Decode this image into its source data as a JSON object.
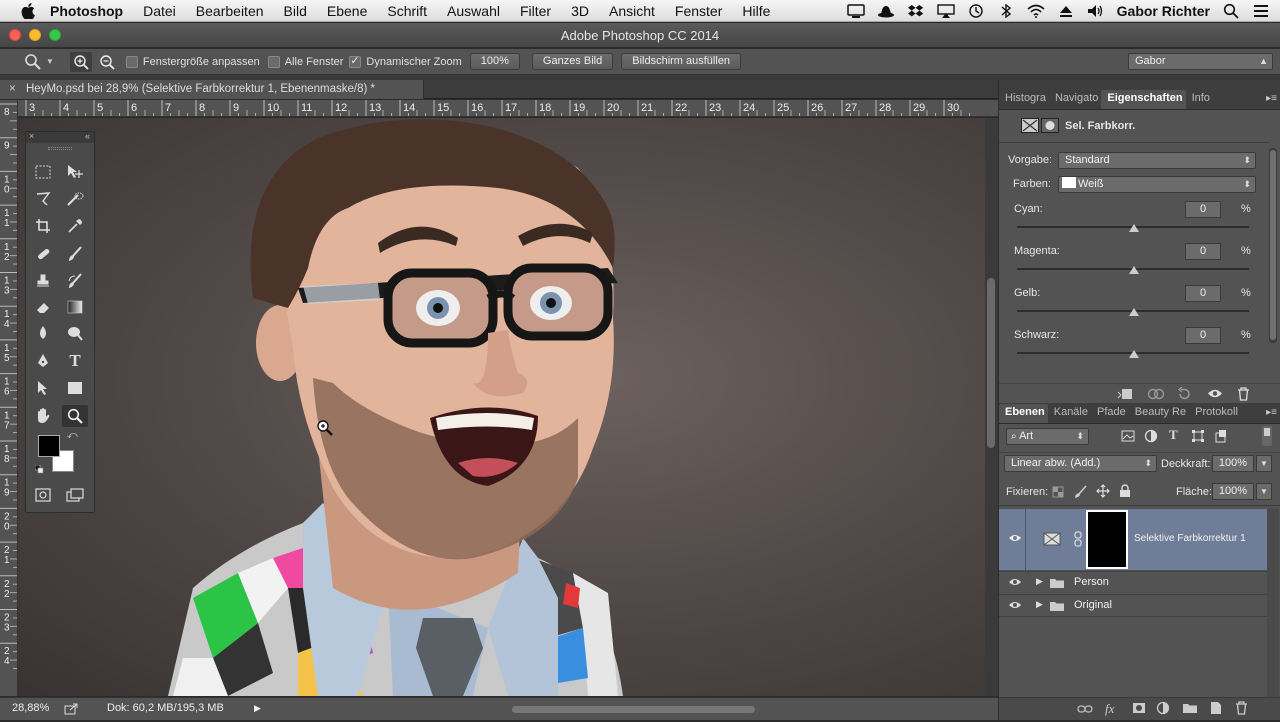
{
  "menubar": {
    "app": "Photoshop",
    "items": [
      "Datei",
      "Bearbeiten",
      "Bild",
      "Ebene",
      "Schrift",
      "Auswahl",
      "Filter",
      "3D",
      "Ansicht",
      "Fenster",
      "Hilfe"
    ],
    "user": "Gabor Richter"
  },
  "window": {
    "title": "Adobe Photoshop CC 2014"
  },
  "options": {
    "resize_windows": "Fenstergröße anpassen",
    "all_windows": "Alle Fenster",
    "scrubby_zoom": "Dynamischer Zoom",
    "btn_100": "100%",
    "btn_fit": "Ganzes Bild",
    "btn_fill": "Bildschirm ausfüllen",
    "workspace": "Gabor"
  },
  "document": {
    "tab_title": "HeyMo.psd bei 28,9% (Selektive Farbkorrektur 1, Ebenenmaske/8) *",
    "ruler_top": [
      "3",
      "4",
      "5",
      "6",
      "7",
      "8",
      "9",
      "10",
      "11",
      "12",
      "13",
      "14",
      "15",
      "16",
      "17",
      "18",
      "19",
      "20",
      "21",
      "22",
      "23",
      "24",
      "25",
      "26",
      "27",
      "28",
      "29",
      "30"
    ],
    "ruler_left": [
      "8",
      "9",
      "1 0",
      "1 1",
      "1 2",
      "1 3",
      "1 4",
      "1 5",
      "1 6",
      "1 7",
      "1 8",
      "1 9",
      "2 0",
      "2 1",
      "2 2",
      "2 3",
      "2 4"
    ]
  },
  "status": {
    "zoom": "28,88%",
    "doc": "Dok: 60,2 MB/195,3 MB"
  },
  "properties": {
    "tabs": [
      "Histogra",
      "Navigato",
      "Eigenschaften",
      "Info"
    ],
    "active_tab": "Eigenschaften",
    "header": "Sel. Farbkorr.",
    "preset_label": "Vorgabe:",
    "preset_value": "Standard",
    "colors_label": "Farben:",
    "colors_value": "Weiß",
    "sliders": [
      {
        "label": "Cyan:",
        "value": "0",
        "unit": "%"
      },
      {
        "label": "Magenta:",
        "value": "0",
        "unit": "%"
      },
      {
        "label": "Gelb:",
        "value": "0",
        "unit": "%"
      },
      {
        "label": "Schwarz:",
        "value": "0",
        "unit": "%"
      }
    ]
  },
  "layers": {
    "tabs": [
      "Ebenen",
      "Kanäle",
      "Pfade",
      "Beauty Re",
      "Protokoll"
    ],
    "active_tab": "Ebenen",
    "filter_kind": "Art",
    "blend_mode": "Linear abw. (Add.)",
    "opacity_label": "Deckkraft:",
    "opacity": "100%",
    "lock_label": "Fixieren:",
    "fill_label": "Fläche:",
    "fill": "100%",
    "items": [
      {
        "name": "Selektive Farbkorrektur 1"
      },
      {
        "name": "Person"
      },
      {
        "name": "Original"
      }
    ]
  },
  "colors": {
    "selection": "#6f7d98",
    "panel": "#535353",
    "dark": "#3e3e3e"
  }
}
